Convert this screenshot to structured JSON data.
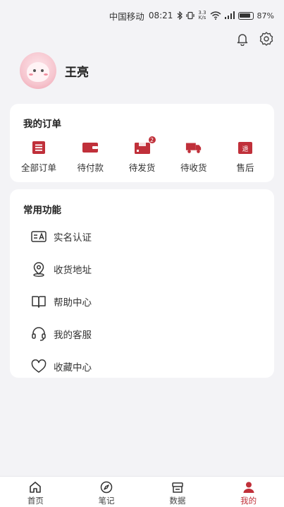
{
  "status_bar": {
    "carrier": "中国移动",
    "time": "08:21",
    "speed_value": "3.3",
    "speed_unit": "K/s",
    "battery": "87%"
  },
  "profile": {
    "username": "王亮"
  },
  "orders": {
    "title": "我的订单",
    "items": [
      {
        "label": "全部订单",
        "icon": "list-icon"
      },
      {
        "label": "待付款",
        "icon": "wallet-icon"
      },
      {
        "label": "待发货",
        "icon": "package-icon",
        "badge": "2"
      },
      {
        "label": "待收货",
        "icon": "truck-icon"
      },
      {
        "label": "售后",
        "icon": "refund-icon",
        "glyph": "退"
      }
    ]
  },
  "functions": {
    "title": "常用功能",
    "items": [
      {
        "label": "实名认证",
        "icon": "id-card-icon"
      },
      {
        "label": "收货地址",
        "icon": "location-icon"
      },
      {
        "label": "帮助中心",
        "icon": "book-icon"
      },
      {
        "label": "我的客服",
        "icon": "headset-icon"
      },
      {
        "label": "收藏中心",
        "icon": "heart-icon"
      }
    ]
  },
  "tabbar": {
    "items": [
      {
        "label": "首页",
        "icon": "home-icon",
        "active": false
      },
      {
        "label": "笔记",
        "icon": "compass-icon",
        "active": false
      },
      {
        "label": "数据",
        "icon": "store-icon",
        "active": false
      },
      {
        "label": "我的",
        "icon": "user-icon",
        "active": true
      }
    ]
  },
  "colors": {
    "accent": "#c0303a",
    "background": "#f3f3f6",
    "card": "#ffffff"
  }
}
